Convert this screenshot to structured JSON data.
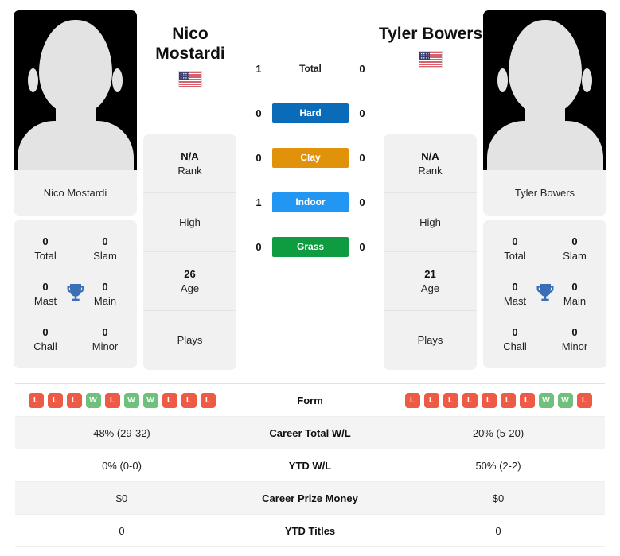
{
  "players": {
    "left": {
      "name": "Nico Mostardi",
      "display_name_line1": "Nico",
      "display_name_line2": "Mostardi",
      "country_flag": "us-flag-icon",
      "rank": "N/A",
      "rank_label": "Rank",
      "high_label": "High",
      "high_value": "",
      "age": "26",
      "age_label": "Age",
      "plays_label": "Plays",
      "plays_value": "",
      "titles": {
        "total": "0",
        "total_label": "Total",
        "slam": "0",
        "slam_label": "Slam",
        "mast": "0",
        "mast_label": "Mast",
        "main": "0",
        "main_label": "Main",
        "chall": "0",
        "chall_label": "Chall",
        "minor": "0",
        "minor_label": "Minor"
      },
      "form": [
        "L",
        "L",
        "L",
        "W",
        "L",
        "W",
        "W",
        "L",
        "L",
        "L"
      ],
      "career_total_wl": "48% (29-32)",
      "ytd_wl": "0% (0-0)",
      "career_prize_money": "$0",
      "ytd_titles": "0"
    },
    "right": {
      "name": "Tyler Bowers",
      "display_name_line1": "Tyler Bowers",
      "display_name_line2": "",
      "country_flag": "us-flag-icon",
      "rank": "N/A",
      "rank_label": "Rank",
      "high_label": "High",
      "high_value": "",
      "age": "21",
      "age_label": "Age",
      "plays_label": "Plays",
      "plays_value": "",
      "titles": {
        "total": "0",
        "total_label": "Total",
        "slam": "0",
        "slam_label": "Slam",
        "mast": "0",
        "mast_label": "Mast",
        "main": "0",
        "main_label": "Main",
        "chall": "0",
        "chall_label": "Chall",
        "minor": "0",
        "minor_label": "Minor"
      },
      "form": [
        "L",
        "L",
        "L",
        "L",
        "L",
        "L",
        "L",
        "W",
        "W",
        "L"
      ],
      "career_total_wl": "20% (5-20)",
      "ytd_wl": "50% (2-2)",
      "career_prize_money": "$0",
      "ytd_titles": "0"
    }
  },
  "head_to_head": [
    {
      "label": "Total",
      "left": "1",
      "right": "0",
      "style": "plain",
      "color": ""
    },
    {
      "label": "Hard",
      "left": "0",
      "right": "0",
      "style": "badge",
      "color": "#0a6cb8"
    },
    {
      "label": "Clay",
      "left": "0",
      "right": "0",
      "style": "badge",
      "color": "#e0920a"
    },
    {
      "label": "Indoor",
      "left": "1",
      "right": "0",
      "style": "badge",
      "color": "#2196f3"
    },
    {
      "label": "Grass",
      "left": "0",
      "right": "0",
      "style": "badge",
      "color": "#0f9b3f"
    }
  ],
  "stats_rows": [
    {
      "key": "form",
      "label": "Form"
    },
    {
      "key": "career_total_wl",
      "label": "Career Total W/L"
    },
    {
      "key": "ytd_wl",
      "label": "YTD W/L"
    },
    {
      "key": "career_prize_money",
      "label": "Career Prize Money"
    },
    {
      "key": "ytd_titles",
      "label": "YTD Titles"
    }
  ],
  "theme": {
    "card_bg": "#f1f1f1",
    "win_color": "#6ec07c",
    "loss_color": "#ed5a45",
    "trophy_color": "#3a6fb5",
    "row_alt_bg": "#f4f4f4"
  }
}
